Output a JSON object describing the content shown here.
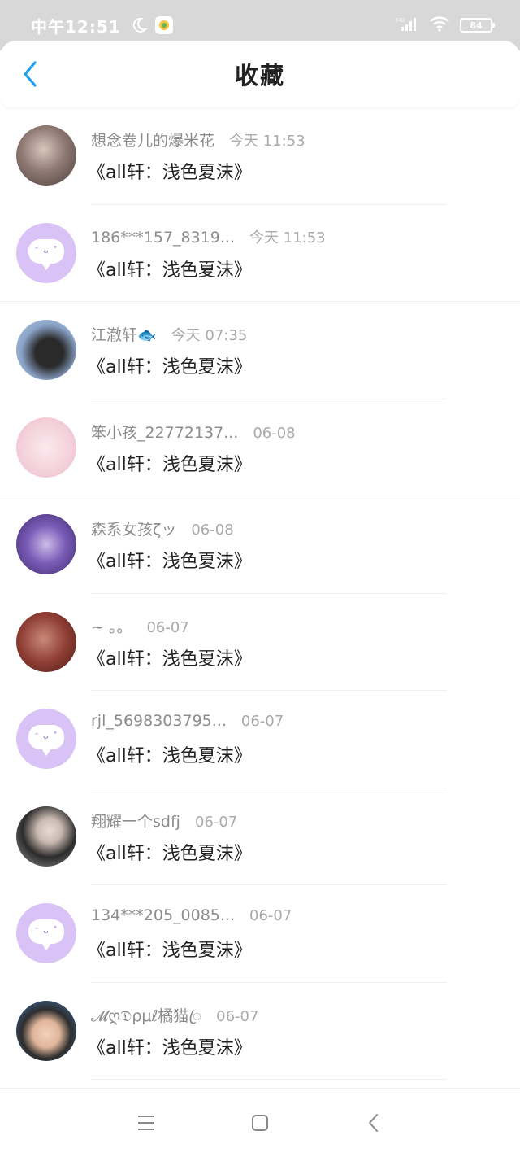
{
  "status_bar": {
    "time": "中午12:51",
    "network": "HD",
    "battery": "84"
  },
  "header": {
    "title": "收藏"
  },
  "list": [
    {
      "name": "想念卷儿的爆米花",
      "time": "今天 11:53",
      "content": "《all轩：浅色夏沫》",
      "avatar": "photo",
      "color": "#6b5a57"
    },
    {
      "name": "186***157_8319...",
      "time": "今天 11:53",
      "content": "《all轩：浅色夏沫》",
      "avatar": "default",
      "color": "#d9c3f6"
    },
    {
      "name": "江澈轩🐟",
      "time": "今天 07:35",
      "content": "《all轩：浅色夏沫》",
      "avatar": "photo",
      "color": "#4c5d7a"
    },
    {
      "name": "笨小孩_22772137...",
      "time": "06-08",
      "content": "《all轩：浅色夏沫》",
      "avatar": "photo",
      "color": "#f1d3dc"
    },
    {
      "name": "森系女孩ζッ",
      "time": "06-08",
      "content": "《all轩：浅色夏沫》",
      "avatar": "photo",
      "color": "#5b3f9a"
    },
    {
      "name": "~ 。。",
      "time": "06-07",
      "content": "《all轩：浅色夏沫》",
      "avatar": "photo",
      "color": "#8a3d33"
    },
    {
      "name": "rjl_5698303795...",
      "time": "06-07",
      "content": "《all轩：浅色夏沫》",
      "avatar": "default",
      "color": "#d9c3f6"
    },
    {
      "name": "翔耀一个sdfj",
      "time": "06-07",
      "content": "《all轩：浅色夏沫》",
      "avatar": "photo",
      "color": "#3a3a3a"
    },
    {
      "name": "134***205_0085...",
      "time": "06-07",
      "content": "《all轩：浅色夏沫》",
      "avatar": "default",
      "color": "#d9c3f6"
    },
    {
      "name": "𝓜ღ𝔇ρμℓ橘猫ꦿ",
      "time": "06-07",
      "content": "《all轩：浅色夏沫》",
      "avatar": "photo",
      "color": "#3b6fa8"
    }
  ],
  "icons": {
    "back": "chevron-left-icon",
    "moon": "moon-icon",
    "wifi": "wifi-icon",
    "signal": "signal-icon",
    "menu": "menu-icon",
    "home": "home-square-icon",
    "nav_back": "nav-back-icon"
  },
  "colors": {
    "accent": "#1e9ff0",
    "default_avatar": "#d9c3f6"
  }
}
